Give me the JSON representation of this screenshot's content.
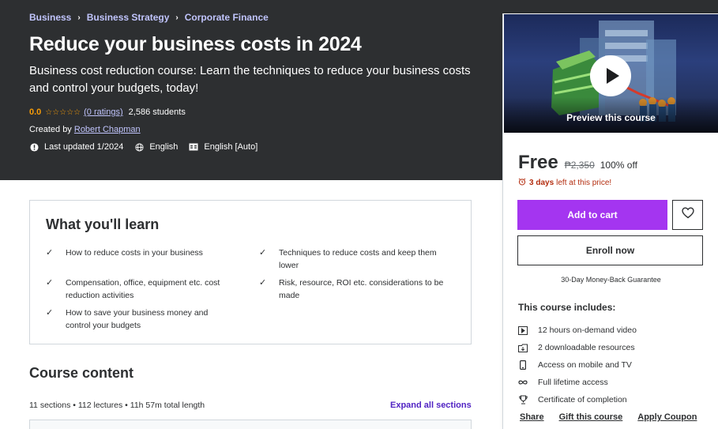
{
  "breadcrumb": [
    "Business",
    "Business Strategy",
    "Corporate Finance"
  ],
  "course": {
    "title": "Reduce your business costs in 2024",
    "subtitle": "Business cost reduction course: Learn the techniques to reduce your business costs and control your budgets, today!",
    "rating": "0.0",
    "stars": "☆☆☆☆☆",
    "ratings_link": "(0 ratings)",
    "students": "2,586 students",
    "created_label": "Created by",
    "author": "Robert Chapman",
    "last_updated": "Last updated 1/2024",
    "language": "English",
    "captions": "English [Auto]"
  },
  "sidebar": {
    "preview_label": "Preview this course",
    "price": "Free",
    "original_price": "₱2,350",
    "discount": "100% off",
    "timer_days": "3 days",
    "timer_text": "left at this price!",
    "add_to_cart": "Add to cart",
    "enroll": "Enroll now",
    "guarantee": "30-Day Money-Back Guarantee",
    "includes_title": "This course includes:",
    "includes": [
      {
        "icon": "video-icon",
        "label": "12 hours on-demand video"
      },
      {
        "icon": "download-icon",
        "label": "2 downloadable resources"
      },
      {
        "icon": "mobile-icon",
        "label": "Access on mobile and TV"
      },
      {
        "icon": "infinity-icon",
        "label": "Full lifetime access"
      },
      {
        "icon": "trophy-icon",
        "label": "Certificate of completion"
      }
    ],
    "links": [
      "Share",
      "Gift this course",
      "Apply Coupon"
    ]
  },
  "learn": {
    "title": "What you'll learn",
    "items": [
      "How to reduce costs in your business",
      "Techniques to reduce costs and keep them lower",
      "Compensation, office, equipment etc. cost reduction activities",
      "Risk, resource, ROI etc. considerations to be made",
      "How to save your business money and control your budgets"
    ]
  },
  "content": {
    "title": "Course content",
    "meta": "11 sections • 112 lectures • 11h 57m total length",
    "expand": "Expand all sections"
  }
}
